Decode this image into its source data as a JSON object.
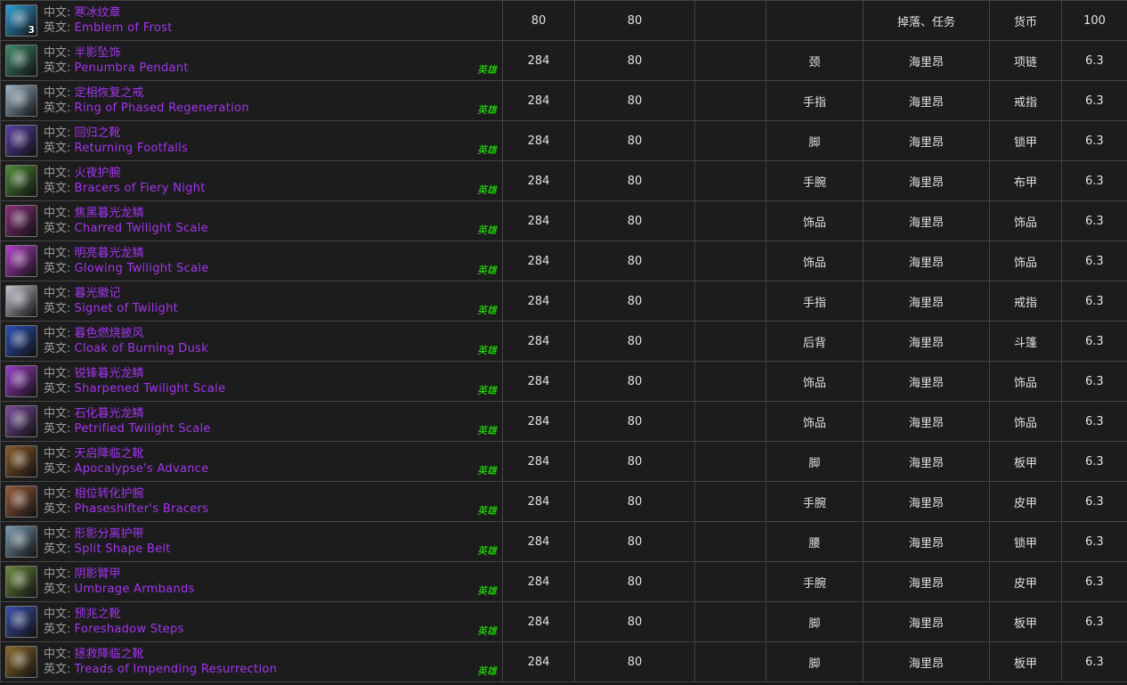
{
  "labels": {
    "cn": "中文:",
    "en": "英文:"
  },
  "rows": [
    {
      "icon": "emblem-of-frost-icon",
      "color": "#2f9fd8",
      "stack": "3",
      "cn": "寒冰纹章",
      "en": "Emblem of Frost",
      "heroic": "",
      "ilvl": "80",
      "level": "80",
      "col3": "",
      "slot": "",
      "source": "掉落、任务",
      "type": "货币",
      "version": "100"
    },
    {
      "icon": "pendant-icon",
      "color": "#3d8a6a",
      "stack": "",
      "cn": "半影坠饰",
      "en": "Penumbra Pendant",
      "heroic": "英雄",
      "ilvl": "284",
      "level": "80",
      "col3": "",
      "slot": "颈",
      "source": "海里昂",
      "type": "项链",
      "version": "6.3"
    },
    {
      "icon": "ring-icon",
      "color": "#9fb6c8",
      "stack": "",
      "cn": "定相恢复之戒",
      "en": "Ring of Phased Regeneration",
      "heroic": "英雄",
      "ilvl": "284",
      "level": "80",
      "col3": "",
      "slot": "手指",
      "source": "海里昂",
      "type": "戒指",
      "version": "6.3"
    },
    {
      "icon": "boots-icon",
      "color": "#5b3fa8",
      "stack": "",
      "cn": "回归之靴",
      "en": "Returning Footfalls",
      "heroic": "英雄",
      "ilvl": "284",
      "level": "80",
      "col3": "",
      "slot": "脚",
      "source": "海里昂",
      "type": "锁甲",
      "version": "6.3"
    },
    {
      "icon": "bracers-icon",
      "color": "#4f8a36",
      "stack": "",
      "cn": "火夜护腕",
      "en": "Bracers of Fiery Night",
      "heroic": "英雄",
      "ilvl": "284",
      "level": "80",
      "col3": "",
      "slot": "手腕",
      "source": "海里昂",
      "type": "布甲",
      "version": "6.3"
    },
    {
      "icon": "dragon-scale-icon",
      "color": "#8a2f7a",
      "stack": "",
      "cn": "焦黑暮光龙鳞",
      "en": "Charred Twilight Scale",
      "heroic": "英雄",
      "ilvl": "284",
      "level": "80",
      "col3": "",
      "slot": "饰品",
      "source": "海里昂",
      "type": "饰品",
      "version": "6.3"
    },
    {
      "icon": "dragon-scale-icon",
      "color": "#b43ec9",
      "stack": "",
      "cn": "明亮暮光龙鳞",
      "en": "Glowing Twilight Scale",
      "heroic": "英雄",
      "ilvl": "284",
      "level": "80",
      "col3": "",
      "slot": "饰品",
      "source": "海里昂",
      "type": "饰品",
      "version": "6.3"
    },
    {
      "icon": "signet-ring-icon",
      "color": "#c8c2d0",
      "stack": "",
      "cn": "暮光徽记",
      "en": "Signet of Twilight",
      "heroic": "英雄",
      "ilvl": "284",
      "level": "80",
      "col3": "",
      "slot": "手指",
      "source": "海里昂",
      "type": "戒指",
      "version": "6.3"
    },
    {
      "icon": "cloak-icon",
      "color": "#2a4fb8",
      "stack": "",
      "cn": "暮色燃烧披风",
      "en": "Cloak of Burning Dusk",
      "heroic": "英雄",
      "ilvl": "284",
      "level": "80",
      "col3": "",
      "slot": "后背",
      "source": "海里昂",
      "type": "斗篷",
      "version": "6.3"
    },
    {
      "icon": "dragon-scale-icon",
      "color": "#9b3cc8",
      "stack": "",
      "cn": "锐锋暮光龙鳞",
      "en": "Sharpened Twilight Scale",
      "heroic": "英雄",
      "ilvl": "284",
      "level": "80",
      "col3": "",
      "slot": "饰品",
      "source": "海里昂",
      "type": "饰品",
      "version": "6.3"
    },
    {
      "icon": "dragon-scale-icon",
      "color": "#7a4a9a",
      "stack": "",
      "cn": "石化暮光龙鳞",
      "en": "Petrified Twilight Scale",
      "heroic": "英雄",
      "ilvl": "284",
      "level": "80",
      "col3": "",
      "slot": "饰品",
      "source": "海里昂",
      "type": "饰品",
      "version": "6.3"
    },
    {
      "icon": "plate-boots-icon",
      "color": "#8a5a2a",
      "stack": "",
      "cn": "天启降临之靴",
      "en": "Apocalypse's Advance",
      "heroic": "英雄",
      "ilvl": "284",
      "level": "80",
      "col3": "",
      "slot": "脚",
      "source": "海里昂",
      "type": "板甲",
      "version": "6.3"
    },
    {
      "icon": "leather-bracers-icon",
      "color": "#9a5a3a",
      "stack": "",
      "cn": "相位转化护腕",
      "en": "Phaseshifter's Bracers",
      "heroic": "英雄",
      "ilvl": "284",
      "level": "80",
      "col3": "",
      "slot": "手腕",
      "source": "海里昂",
      "type": "皮甲",
      "version": "6.3"
    },
    {
      "icon": "belt-icon",
      "color": "#7a9ab0",
      "stack": "",
      "cn": "形影分离护带",
      "en": "Split Shape Belt",
      "heroic": "英雄",
      "ilvl": "284",
      "level": "80",
      "col3": "",
      "slot": "腰",
      "source": "海里昂",
      "type": "锁甲",
      "version": "6.3"
    },
    {
      "icon": "armbands-icon",
      "color": "#6a8a3a",
      "stack": "",
      "cn": "阴影臂甲",
      "en": "Umbrage Armbands",
      "heroic": "英雄",
      "ilvl": "284",
      "level": "80",
      "col3": "",
      "slot": "手腕",
      "source": "海里昂",
      "type": "皮甲",
      "version": "6.3"
    },
    {
      "icon": "boots-icon",
      "color": "#3a4fb0",
      "stack": "",
      "cn": "预兆之靴",
      "en": "Foreshadow Steps",
      "heroic": "英雄",
      "ilvl": "284",
      "level": "80",
      "col3": "",
      "slot": "脚",
      "source": "海里昂",
      "type": "板甲",
      "version": "6.3"
    },
    {
      "icon": "plate-boots-icon",
      "color": "#8a6a2a",
      "stack": "",
      "cn": "拯救降临之靴",
      "en": "Treads of Impending Resurrection",
      "heroic": "英雄",
      "ilvl": "284",
      "level": "80",
      "col3": "",
      "slot": "脚",
      "source": "海里昂",
      "type": "板甲",
      "version": "6.3"
    }
  ]
}
